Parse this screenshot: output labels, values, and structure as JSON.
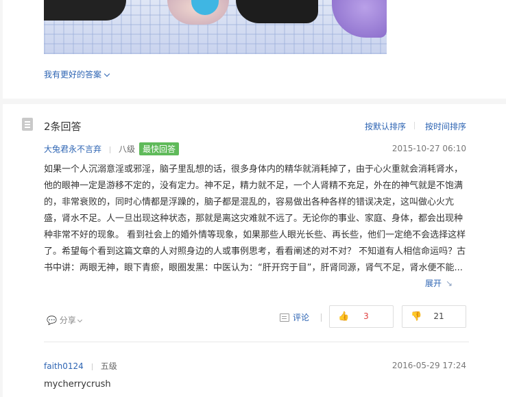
{
  "top": {
    "better_answer": "我有更好的答案"
  },
  "answers": {
    "count_title": "2条回答",
    "sort_default": "按默认排序",
    "sort_time": "按时间排序"
  },
  "answer1": {
    "user": "大兔君永不言弃",
    "level": "八级",
    "badge": "最快回答",
    "time": "2015-10-27 06:10",
    "body": "如果一个人沉溺意淫或邪淫，脑子里乱想的话，很多身体内的精华就消耗掉了，由于心火重就会消耗肾水，他的眼神一定是游移不定的，没有定力。神不足，精力就不足，一个人肾精不充足，外在的神气就是不饱满的，非常衰败的，同时心情都是浮躁的，脑子都是混乱的，容易做出各种各样的错误决定，这叫做心火亢盛，肾水不足。人一旦出现这种状态，那就是离这灾难就不远了。无论你的事业、家庭、身体，都会出现种种非常不好的现象。 看到社会上的婚外情等现象，如果那些人眼光长些、再长些，他们一定绝不会选择这样了。希望每个看到这篇文章的人对照身边的人或事例思考，看看阐述的对不对？ 不知道有人相信命运吗？古书中讲：两眼无神，眼下青瘀，眼圈发黑：中医认为：“肝开窍于目”，肝肾同源，肾气不足，肾水便不能...",
    "expand": "展开",
    "share": "分享",
    "comment": "评论",
    "up_count": "3",
    "down_count": "21"
  },
  "answer2": {
    "user": "faith0124",
    "level": "五级",
    "time": "2016-05-29 17:24",
    "body": "mycherrycrush"
  },
  "icons": {
    "list": "list-icon",
    "thumb_up": "thumbs-up-icon",
    "thumb_down": "thumbs-down-icon",
    "share": "chat-bubbles-icon",
    "comment": "comment-icon",
    "expand": "arrow-down-right-icon"
  },
  "colors": {
    "link": "#2d64b3",
    "badge": "#5fba5a",
    "up": "#e04040"
  }
}
